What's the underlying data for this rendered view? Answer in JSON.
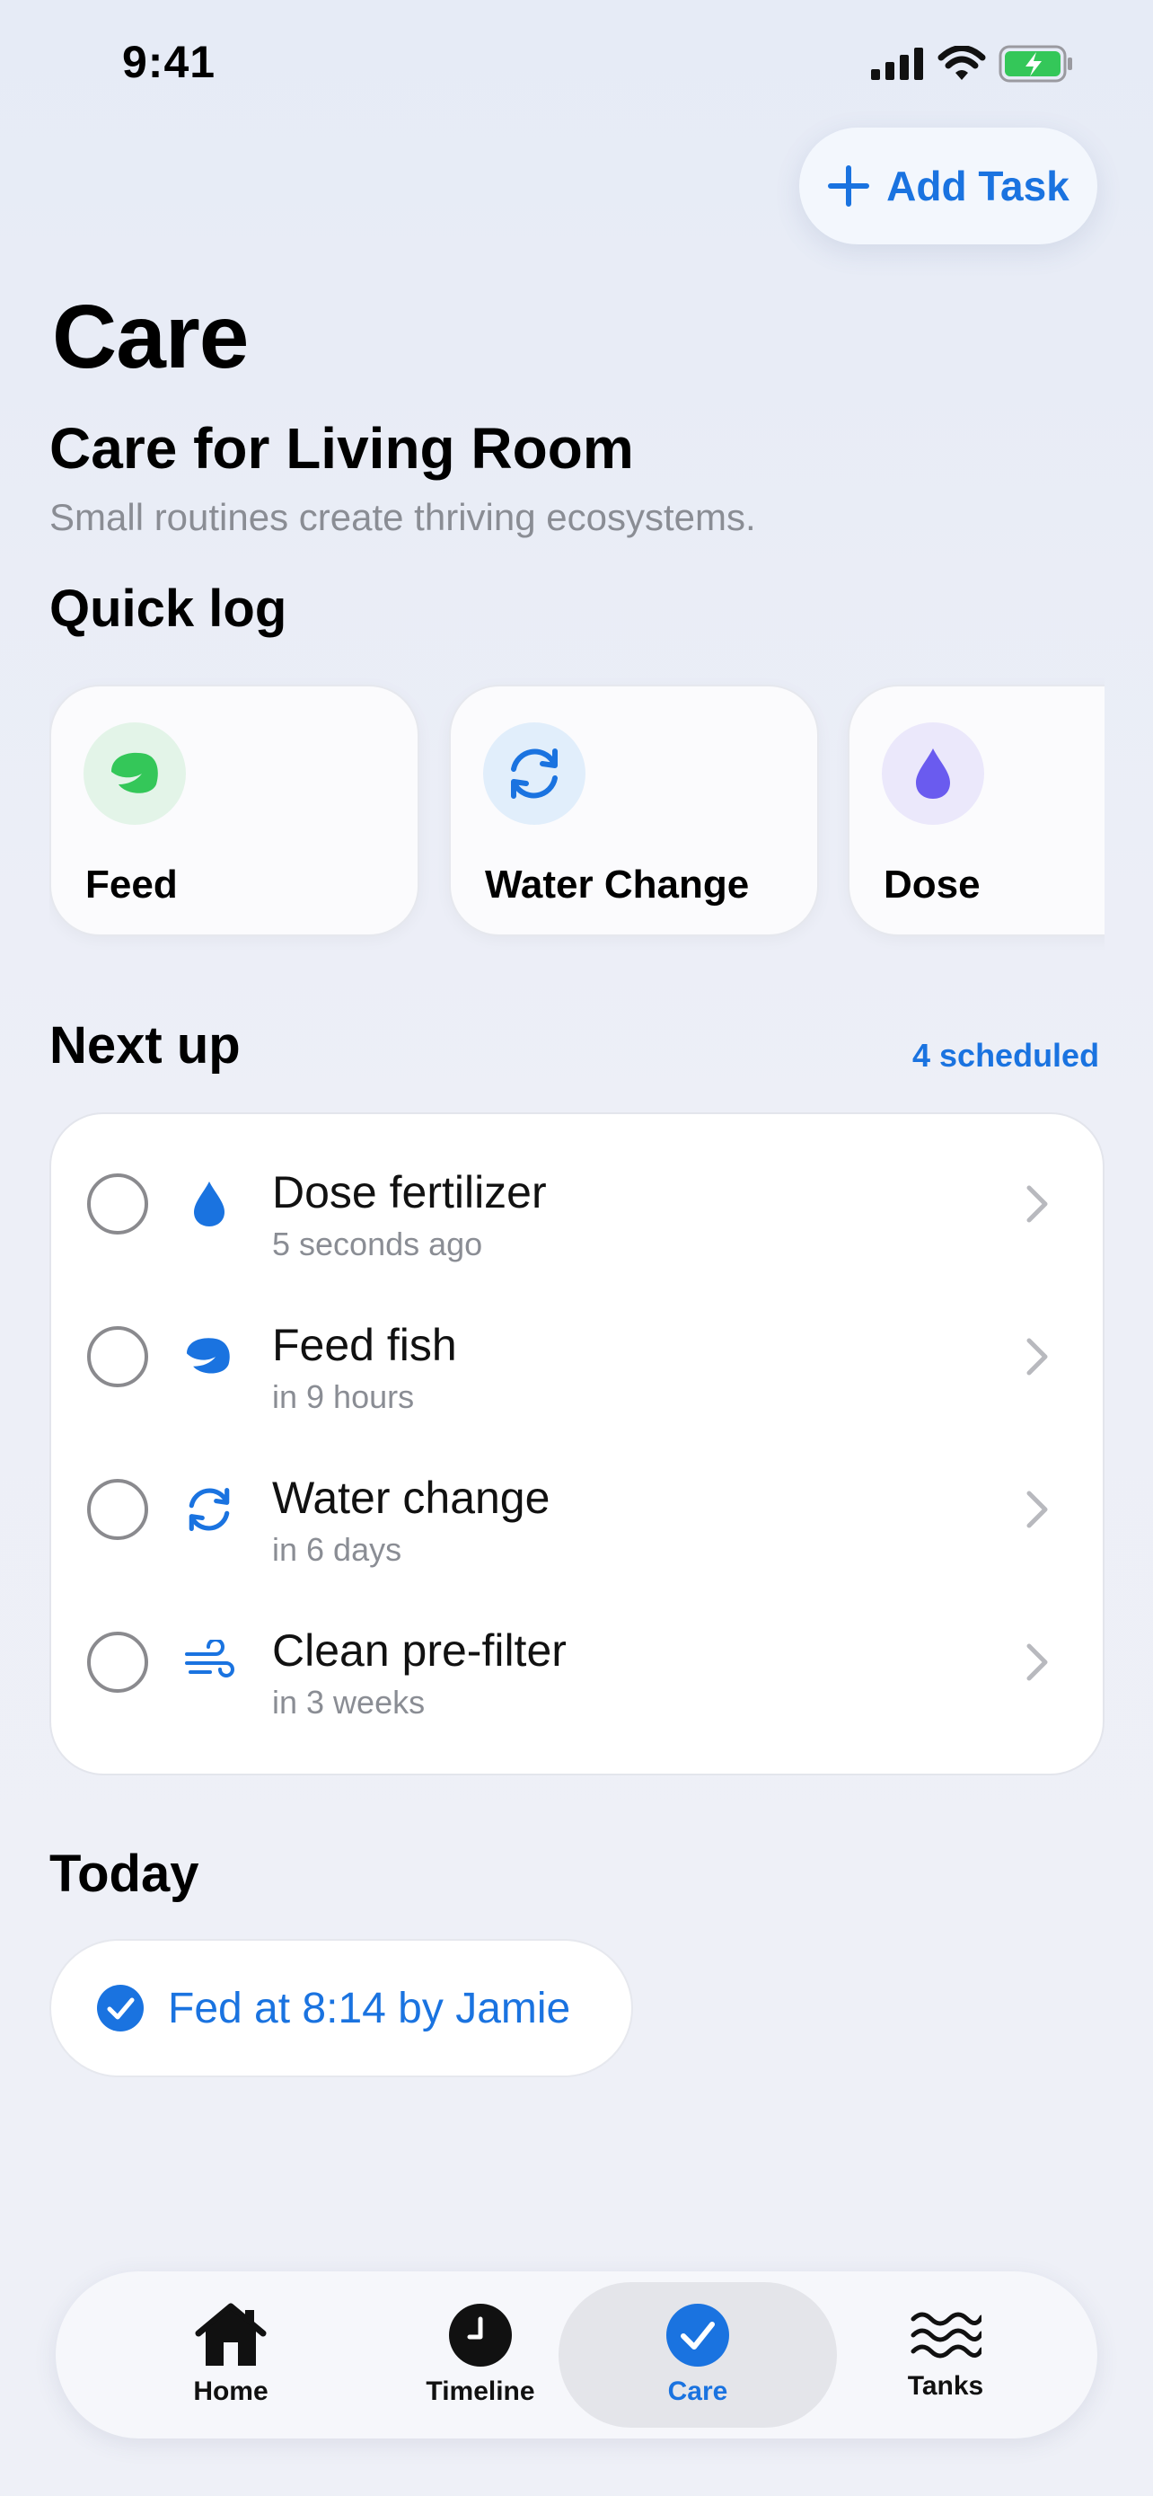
{
  "status": {
    "time": "9:41"
  },
  "header": {
    "add_task_label": "Add Task",
    "title": "Care",
    "room_title": "Care for Living Room",
    "subtitle": "Small routines create thriving ecosystems."
  },
  "quick_log": {
    "title": "Quick log",
    "items": [
      {
        "label": "Feed",
        "icon": "leaf-icon",
        "icon_color": "#34c759",
        "bg": "#e3f4e8"
      },
      {
        "label": "Water Change",
        "icon": "refresh-icon",
        "icon_color": "#1a73e0",
        "bg": "#e1eefb"
      },
      {
        "label": "Dose",
        "icon": "drop-icon",
        "icon_color": "#6a5bef",
        "bg": "#ebe8fb"
      }
    ]
  },
  "next_up": {
    "title": "Next up",
    "count_label": "4 scheduled",
    "tasks": [
      {
        "title": "Dose fertilizer",
        "subtitle": "5 seconds ago",
        "icon": "drop-icon"
      },
      {
        "title": "Feed fish",
        "subtitle": "in 9 hours",
        "icon": "leaf-icon"
      },
      {
        "title": "Water change",
        "subtitle": "in 6 days",
        "icon": "refresh-icon"
      },
      {
        "title": "Clean pre-filter",
        "subtitle": "in 3 weeks",
        "icon": "wind-icon"
      }
    ]
  },
  "today": {
    "title": "Today",
    "entries": [
      {
        "text": "Fed at 8:14 by Jamie",
        "icon": "checkmark-circle-icon"
      }
    ]
  },
  "tabbar": {
    "tabs": [
      {
        "label": "Home",
        "icon": "house-icon"
      },
      {
        "label": "Timeline",
        "icon": "clock-icon"
      },
      {
        "label": "Care",
        "icon": "checkmark-circle-icon",
        "active": true
      },
      {
        "label": "Tanks",
        "icon": "waves-icon"
      }
    ]
  },
  "colors": {
    "accent": "#1a73e0",
    "battery": "#34c759"
  }
}
